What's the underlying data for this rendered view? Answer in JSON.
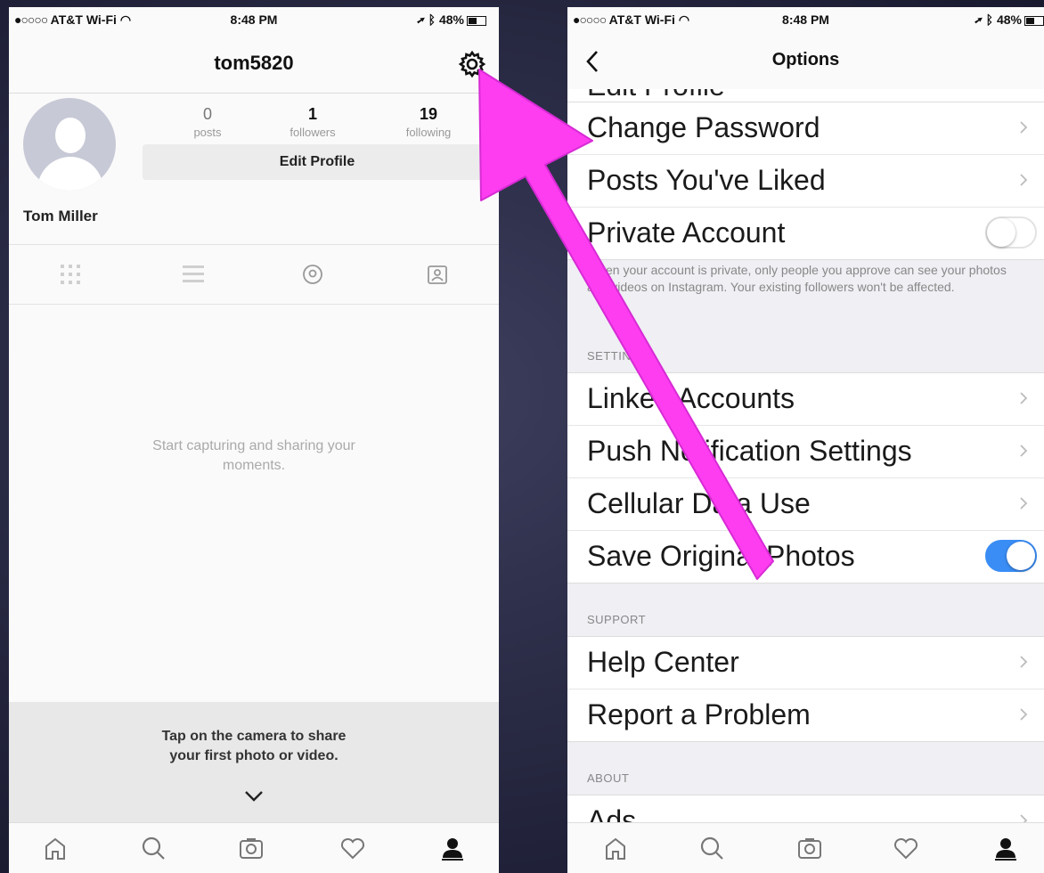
{
  "left_screen": {
    "status_bar": {
      "carrier": "AT&T Wi-Fi",
      "time": "8:48 PM",
      "battery": "48%"
    },
    "header": {
      "username": "tom5820",
      "settings_icon": "gear-icon"
    },
    "stats": [
      {
        "value": "0",
        "label": "posts"
      },
      {
        "value": "1",
        "label": "followers"
      },
      {
        "value": "19",
        "label": "following"
      }
    ],
    "edit_profile_label": "Edit Profile",
    "display_name": "Tom Miller",
    "view_tabs": [
      "grid-icon",
      "list-icon",
      "location-pin-icon",
      "tagged-photos-icon"
    ],
    "empty_state": [
      "Start capturing and sharing your",
      "moments."
    ],
    "prompt": [
      "Tap on the camera to share",
      "your first photo or video."
    ],
    "tab_bar": [
      "home-icon",
      "search-icon",
      "camera-icon",
      "heart-icon",
      "profile-icon"
    ]
  },
  "right_screen": {
    "status_bar": {
      "carrier": "AT&T Wi-Fi",
      "time": "8:48 PM",
      "battery": "48%"
    },
    "header": {
      "title": "Options"
    },
    "partial_row_label": "Edit Profile",
    "account_rows": [
      {
        "label": "Change Password",
        "control": "chevron"
      },
      {
        "label": "Posts You've Liked",
        "control": "chevron"
      },
      {
        "label": "Private Account",
        "control": "toggle",
        "toggle_on": false
      }
    ],
    "private_account_note": "When your account is private, only people you approve can see your photos and videos on Instagram. Your existing followers won't be affected.",
    "settings_header": "SETTINGS",
    "settings_rows": [
      {
        "label": "Linked Accounts",
        "control": "chevron"
      },
      {
        "label": "Push Notification Settings",
        "control": "chevron"
      },
      {
        "label": "Cellular Data Use",
        "control": "chevron"
      },
      {
        "label": "Save Original Photos",
        "control": "toggle",
        "toggle_on": true
      }
    ],
    "support_header": "SUPPORT",
    "support_rows": [
      {
        "label": "Help Center",
        "control": "chevron"
      },
      {
        "label": "Report a Problem",
        "control": "chevron"
      }
    ],
    "about_header": "ABOUT",
    "about_rows": [
      {
        "label": "Ads",
        "control": "chevron"
      }
    ],
    "tab_bar": [
      "home-icon",
      "search-icon",
      "camera-icon",
      "heart-icon",
      "profile-icon"
    ]
  },
  "annotation": {
    "arrow_color": "#ff3df0",
    "points_to": "gear-icon"
  }
}
